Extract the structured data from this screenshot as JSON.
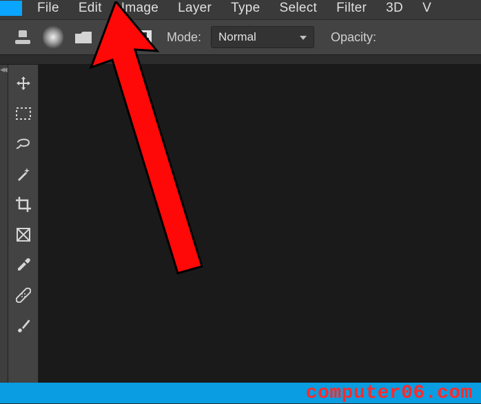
{
  "menubar": {
    "items": [
      "File",
      "Edit",
      "Image",
      "Layer",
      "Type",
      "Select",
      "Filter",
      "3D",
      "V"
    ]
  },
  "options": {
    "mode_label": "Mode:",
    "mode_value": "Normal",
    "opacity_label": "Opacity:"
  },
  "watermark": "computer06.com",
  "tools": [
    "move-tool",
    "marquee-tool",
    "lasso-tool",
    "magic-wand-tool",
    "crop-tool",
    "frame-tool",
    "eyedropper-tool",
    "healing-brush-tool",
    "brush-tool"
  ],
  "colors": {
    "accent": "#0a9de2",
    "arrow": "#ff0000",
    "watermark_text": "#ff2a2a"
  }
}
